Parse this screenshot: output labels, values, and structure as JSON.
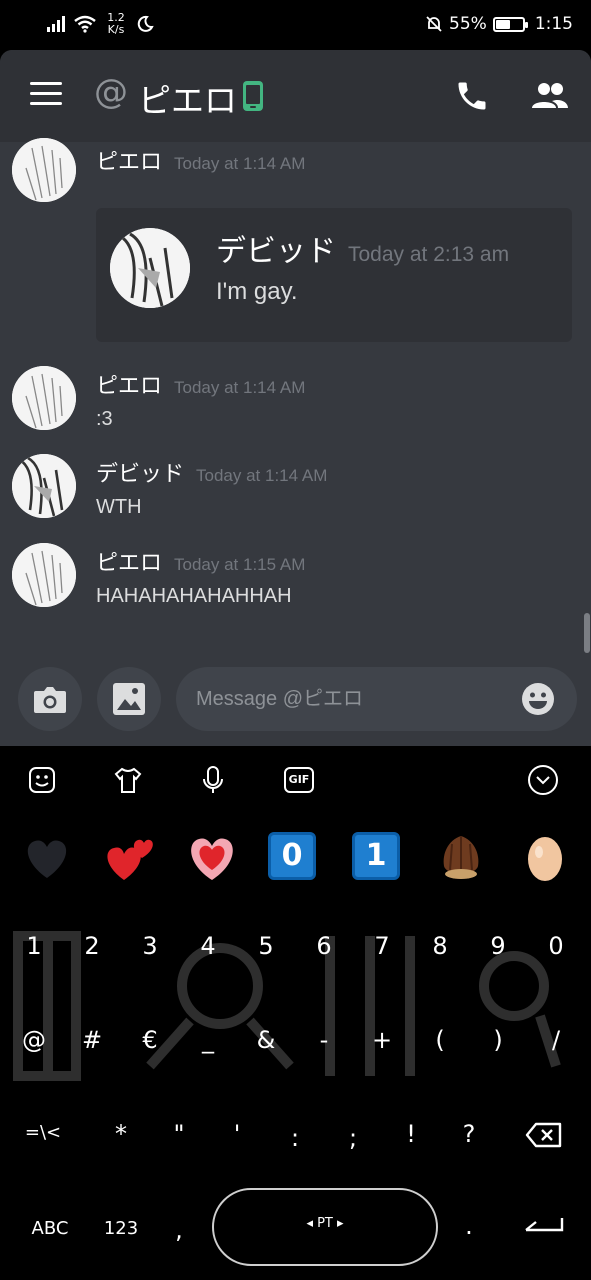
{
  "status_bar": {
    "speed_value": "1.2",
    "speed_unit": "K/s",
    "battery_percent": "55%",
    "battery_level": 0.55,
    "time": "1:15"
  },
  "header": {
    "at_symbol": "@",
    "title": "ピエロ",
    "icons": [
      "menu-icon",
      "at-icon",
      "mobile-phone-icon",
      "phone-call-icon",
      "members-icon"
    ]
  },
  "messages": [
    {
      "author": "ピエロ",
      "time": "Today at 1:14 AM",
      "text": ""
    },
    {
      "author": "ピエロ",
      "time": "Today at 1:14 AM",
      "text": ":3"
    },
    {
      "author": "デビッド",
      "time": "Today at 1:14 AM",
      "text": "WTH"
    },
    {
      "author": "ピエロ",
      "time": "Today at 1:15 AM",
      "text": "HAHAHAHAHAHHAH"
    }
  ],
  "embed": {
    "author": "デビッド",
    "time": "Today at 2:13 am",
    "text": "I'm gay."
  },
  "composer": {
    "placeholder": "Message @ピエロ",
    "icons": [
      "camera-icon",
      "image-icon",
      "emoji-icon"
    ]
  },
  "keyboard": {
    "toolbar_icons": [
      "sticker-icon",
      "tshirt-icon",
      "microphone-icon",
      "gif-icon",
      "collapse-icon"
    ],
    "gif_label": "GIF",
    "emoji_row": [
      "black-heart",
      "two-hearts",
      "growing-heart",
      "keycap-0",
      "keycap-1",
      "chestnut",
      "egg"
    ],
    "keycap_0": "0",
    "keycap_1": "1",
    "row1": [
      "1",
      "2",
      "3",
      "4",
      "5",
      "6",
      "7",
      "8",
      "9",
      "0"
    ],
    "row2": [
      "@",
      "#",
      "€",
      "_",
      "&",
      "-",
      "+",
      "(",
      ")",
      "/"
    ],
    "row3": [
      "=\\<",
      "*",
      "\"",
      "'",
      ":",
      ";",
      "!",
      "?"
    ],
    "row4_left": [
      "ABC",
      "123",
      ","
    ],
    "space_label": "◂ PT ▸",
    "row4_right": [
      "."
    ],
    "accent_colors": {
      "discord_bg": "#36393f",
      "header_bg": "#2f3136",
      "mobile_green": "#43b581"
    }
  }
}
